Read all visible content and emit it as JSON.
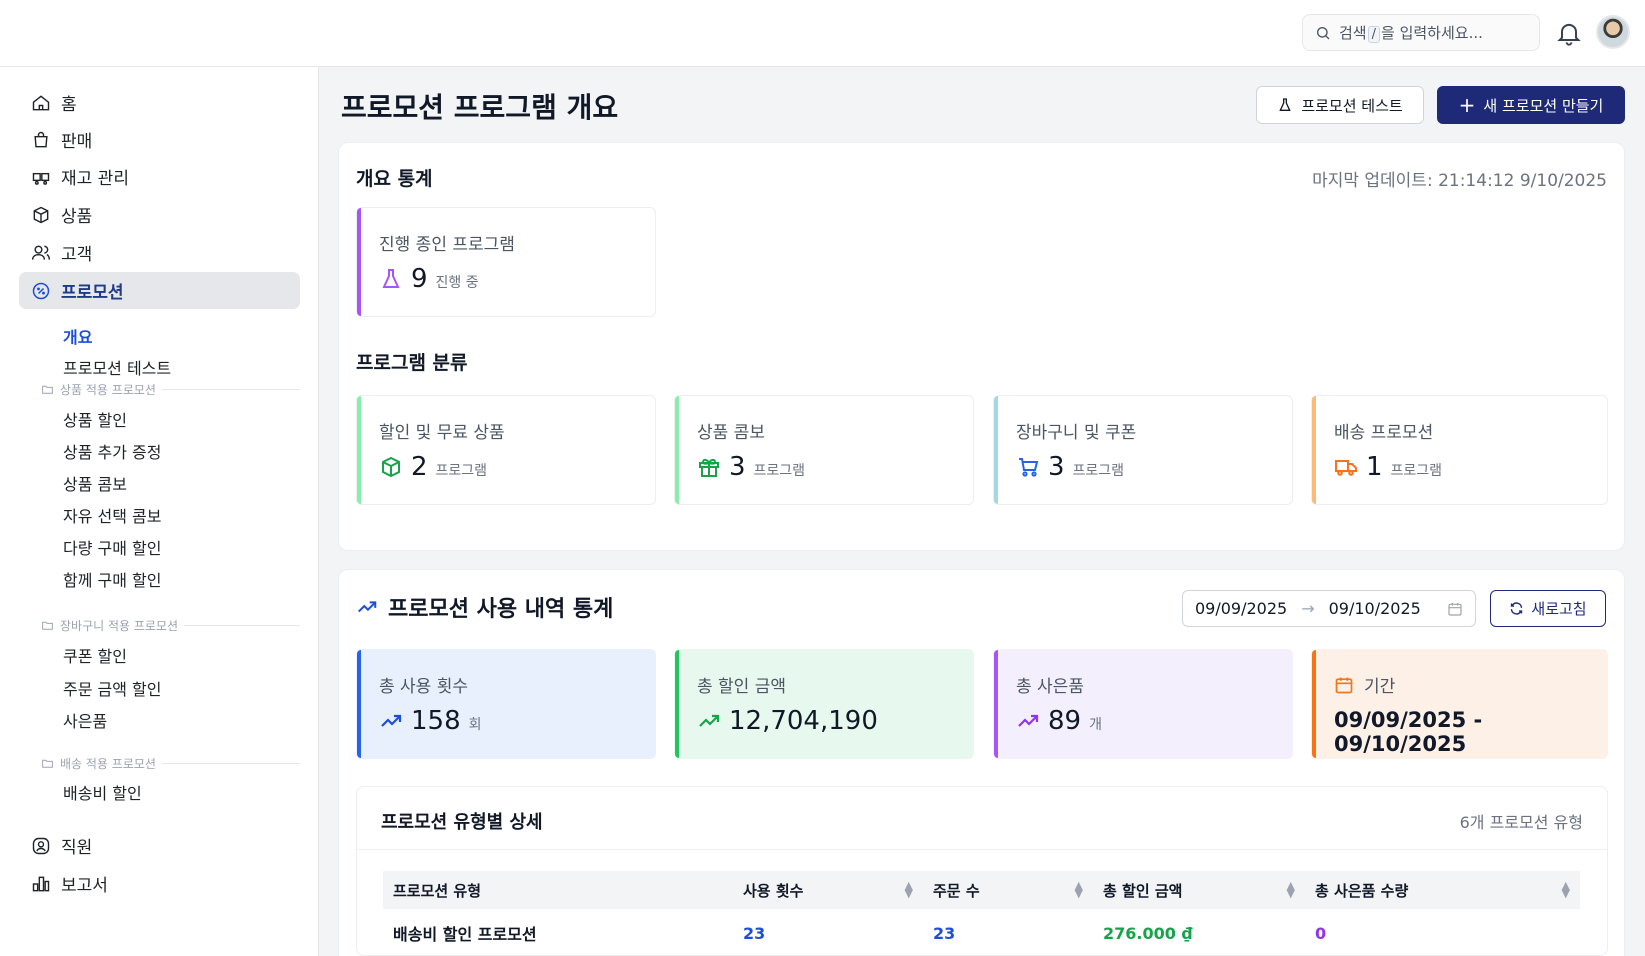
{
  "header": {
    "search_prefix": "검색",
    "search_key": "/",
    "search_suffix": "을 입력하세요..."
  },
  "sidebar": {
    "items": [
      {
        "label": "홈",
        "icon": "home-icon"
      },
      {
        "label": "판매",
        "icon": "shopping-bag-icon"
      },
      {
        "label": "재고 관리",
        "icon": "warehouse-icon"
      },
      {
        "label": "상품",
        "icon": "box-icon"
      },
      {
        "label": "고객",
        "icon": "users-icon"
      },
      {
        "label": "프로모션",
        "icon": "percent-badge-icon"
      }
    ],
    "promo_sub": [
      "개요",
      "프로모션 테스트"
    ],
    "groups": [
      {
        "title": "상품 적용 프로모션",
        "items": [
          "상품 할인",
          "상품 추가 증정",
          "상품 콤보",
          "자유 선택 콤보",
          "다량 구매 할인",
          "함께 구매 할인"
        ]
      },
      {
        "title": "장바구니 적용 프로모션",
        "items": [
          "쿠폰 할인",
          "주문 금액 할인",
          "사은품"
        ]
      },
      {
        "title": "배송 적용 프로모션",
        "items": [
          "배송비 할인"
        ]
      }
    ],
    "bottom_items": [
      {
        "label": "직원",
        "icon": "user-circle-icon"
      },
      {
        "label": "보고서",
        "icon": "bar-chart-icon"
      }
    ]
  },
  "page": {
    "title": "프로모션 프로그램 개요",
    "test_button": "프로모션 테스트",
    "new_button": "새 프로모션 만들기"
  },
  "overview": {
    "title": "개요 통계",
    "last_update": "마지막 업데이트: 21:14:12 9/10/2025",
    "active": {
      "label": "진행 종인 프로그램",
      "value": "9",
      "unit": "진행 중",
      "color": "#a855f7"
    },
    "categories_title": "프로그램 분류",
    "categories": [
      {
        "label": "할인 및 무료 상품",
        "value": "2",
        "unit": "프로그램",
        "color": "#86efac",
        "icon_color": "#16a34a"
      },
      {
        "label": "상품 콤보",
        "value": "3",
        "unit": "프로그램",
        "color": "#86efac",
        "icon_color": "#16a34a"
      },
      {
        "label": "장바구니 및 쿠폰",
        "value": "3",
        "unit": "프로그램",
        "color": "#a5d8e6",
        "icon_color": "#2563eb"
      },
      {
        "label": "배송 프로모션",
        "value": "1",
        "unit": "프로그램",
        "color": "#fdba74",
        "icon_color": "#f97316"
      }
    ]
  },
  "usage": {
    "title": "프로모션 사용 내역 통계",
    "date_from": "09/09/2025",
    "date_to": "09/10/2025",
    "refresh": "새로고침",
    "stats": [
      {
        "label": "총 사용 횟수",
        "value": "158",
        "unit": "회",
        "bg": "#e8f0fd",
        "bar": "#2563eb",
        "icon_color": "#1d4ed8"
      },
      {
        "label": "총 할인 금액",
        "value": "12,704,190",
        "unit": "",
        "bg": "#e7f8ee",
        "bar": "#22c55e",
        "icon_color": "#16a34a"
      },
      {
        "label": "총 사은품",
        "value": "89",
        "unit": "개",
        "bg": "#f3effc",
        "bar": "#a855f7",
        "icon_color": "#9333ea"
      }
    ],
    "period": {
      "label": "기간",
      "value": "09/09/2025 - 09/10/2025",
      "bg": "#fdf0e6",
      "bar": "#f97316"
    }
  },
  "detail": {
    "title": "프로모션 유형별 상세",
    "count_text": "6개 프로모션 유형",
    "columns": [
      "프로모션 유형",
      "사용 횟수",
      "주문 수",
      "총 할인 금액",
      "총 사은품 수량"
    ],
    "rows": [
      {
        "type": "배송비 할인 프로모션",
        "uses": "23",
        "orders": "23",
        "discount": "276.000 ₫",
        "gifts": "0"
      }
    ]
  }
}
